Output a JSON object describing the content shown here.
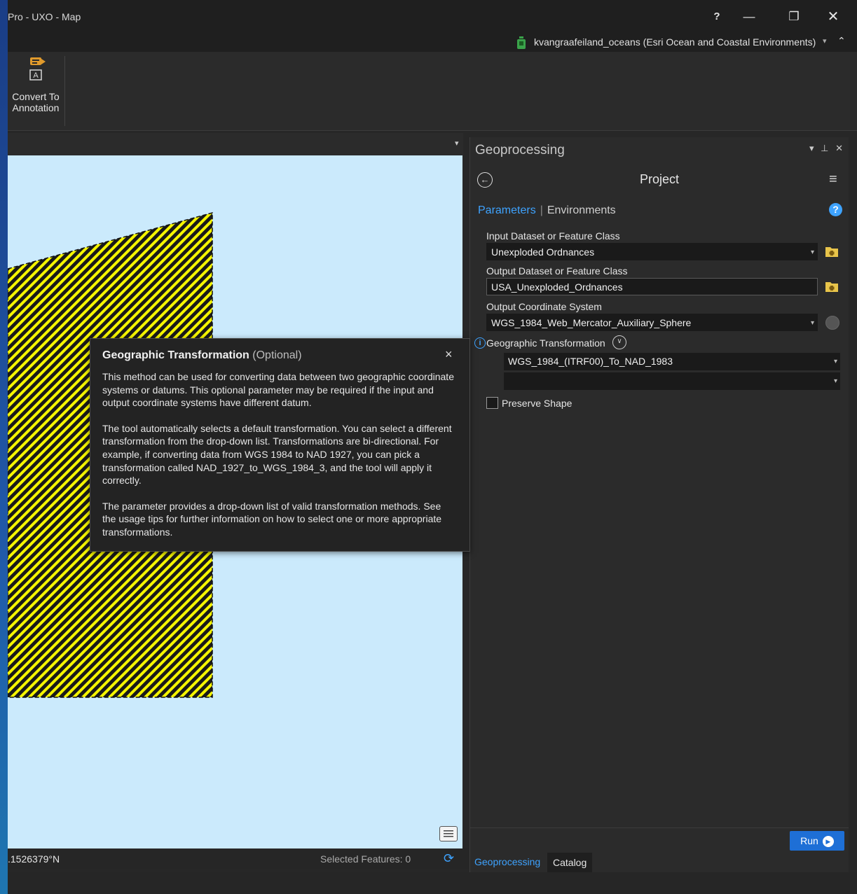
{
  "window": {
    "title": "Pro - UXO - Map",
    "help": "?",
    "minimize": "—",
    "maximize": "❐",
    "close": "✕"
  },
  "user": {
    "name": "kvangraafeiland_oceans (Esri Ocean and Coastal Environments)",
    "dropdown": "▾",
    "collapse": "⌃"
  },
  "ribbon": {
    "convert_annotation_label": "Convert To Annotation"
  },
  "map": {
    "header_dropdown": "▾",
    "status_coords": ".1526379°N",
    "selected_features": "Selected Features: 0",
    "colors": {
      "water": "#cbeafc",
      "hatch": "#f5f500"
    }
  },
  "tooltip": {
    "title": "Geographic Transformation",
    "optional": "(Optional)",
    "close": "×",
    "paragraphs": [
      "This method can be used for converting data between two geographic coordinate systems or datums. This optional parameter may be required if the input and output coordinate systems have different datum.",
      "The tool automatically selects a default transformation. You can select a different transformation from the drop-down list. Transformations are bi-directional.  For example, if converting data from WGS 1984 to NAD 1927, you can pick a transformation called NAD_1927_to_WGS_1984_3, and the tool will apply it correctly.",
      "The parameter provides a drop-down list of valid transformation methods. See the usage tips for further information on how to select one or more appropriate transformations."
    ]
  },
  "geoprocessing": {
    "pane_title": "Geoprocessing",
    "pane_controls": "▾ ⊥ ✕",
    "tool_name": "Project",
    "tabs": {
      "parameters": "Parameters",
      "environments": "Environments"
    },
    "help": "?",
    "params": {
      "input_label": "Input Dataset or Feature Class",
      "input_value": "Unexploded Ordnances",
      "output_label": "Output Dataset or Feature Class",
      "output_value": "USA_Unexploded_Ordnances",
      "coord_label": "Output Coordinate System",
      "coord_value": "WGS_1984_Web_Mercator_Auxiliary_Sphere",
      "gt_label": "Geographic Transformation",
      "gt_value_1": "WGS_1984_(ITRF00)_To_NAD_1983",
      "gt_value_2": "",
      "preserve_shape": "Preserve Shape"
    },
    "run_label": "Run",
    "bottom_tabs": {
      "geoprocessing": "Geoprocessing",
      "catalog": "Catalog"
    }
  },
  "colors": {
    "accent": "#3ea3ff",
    "run": "#1e6fd6",
    "background": "#272727"
  }
}
